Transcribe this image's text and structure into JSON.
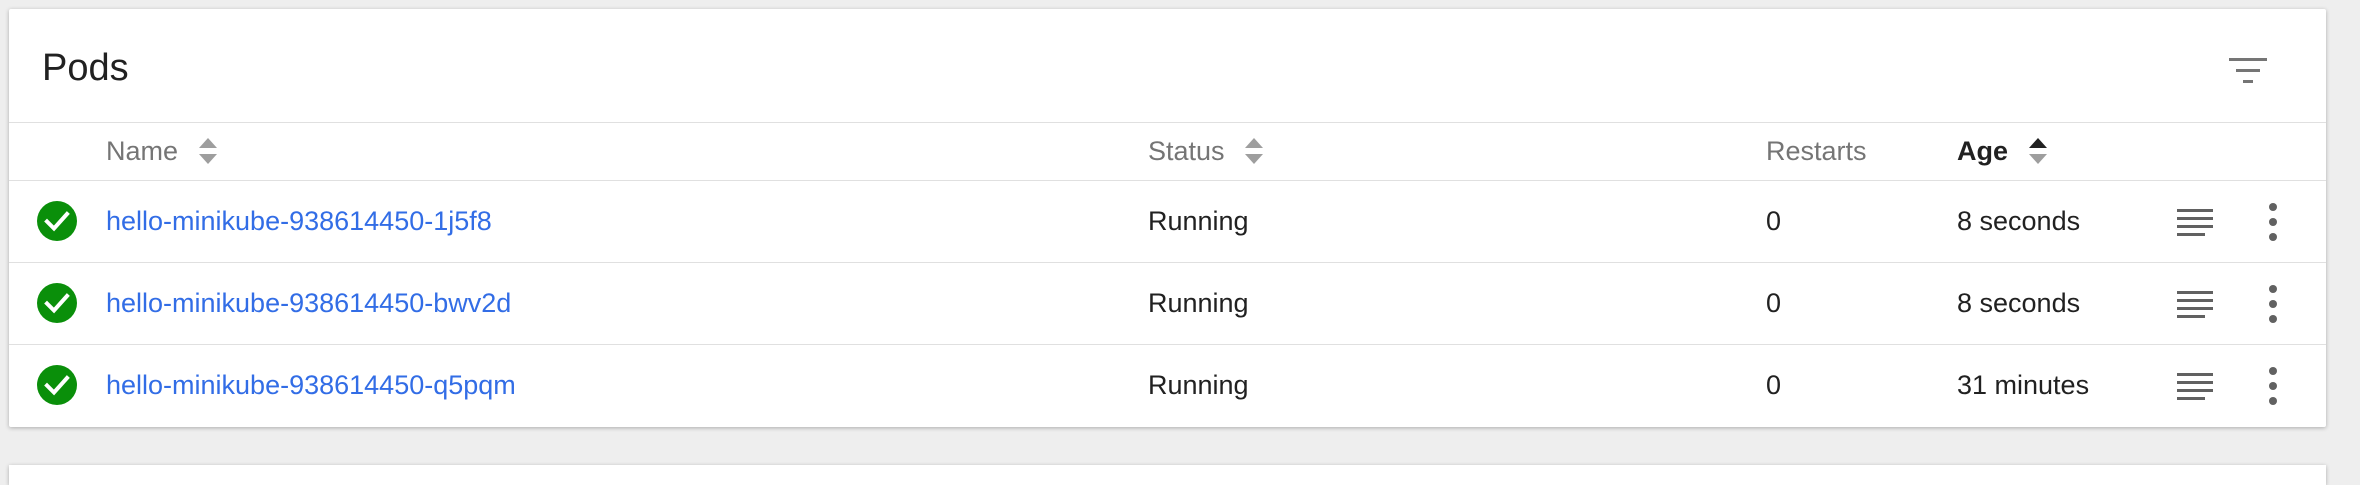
{
  "card": {
    "title": "Pods",
    "filter_icon": "filter-icon"
  },
  "columns": [
    {
      "label": "Name",
      "sortable": true,
      "active": false
    },
    {
      "label": "Status",
      "sortable": true,
      "active": false
    },
    {
      "label": "Restarts",
      "sortable": false,
      "active": false
    },
    {
      "label": "Age",
      "sortable": true,
      "active": true,
      "direction": "ascending"
    }
  ],
  "rows": [
    {
      "name": "hello-minikube-938614450-1j5f8",
      "status": "Running",
      "restarts": "0",
      "age": "8 seconds",
      "status_icon": "check-circle-icon"
    },
    {
      "name": "hello-minikube-938614450-bwv2d",
      "status": "Running",
      "restarts": "0",
      "age": "8 seconds",
      "status_icon": "check-circle-icon"
    },
    {
      "name": "hello-minikube-938614450-q5pqm",
      "status": "Running",
      "restarts": "0",
      "age": "31 minutes",
      "status_icon": "check-circle-icon"
    }
  ],
  "colors": {
    "link": "#326de6",
    "success": "#0a8f0a",
    "header_text": "#757575",
    "text": "#212121",
    "divider": "#e0e0e0",
    "background": "#eeeeee"
  }
}
